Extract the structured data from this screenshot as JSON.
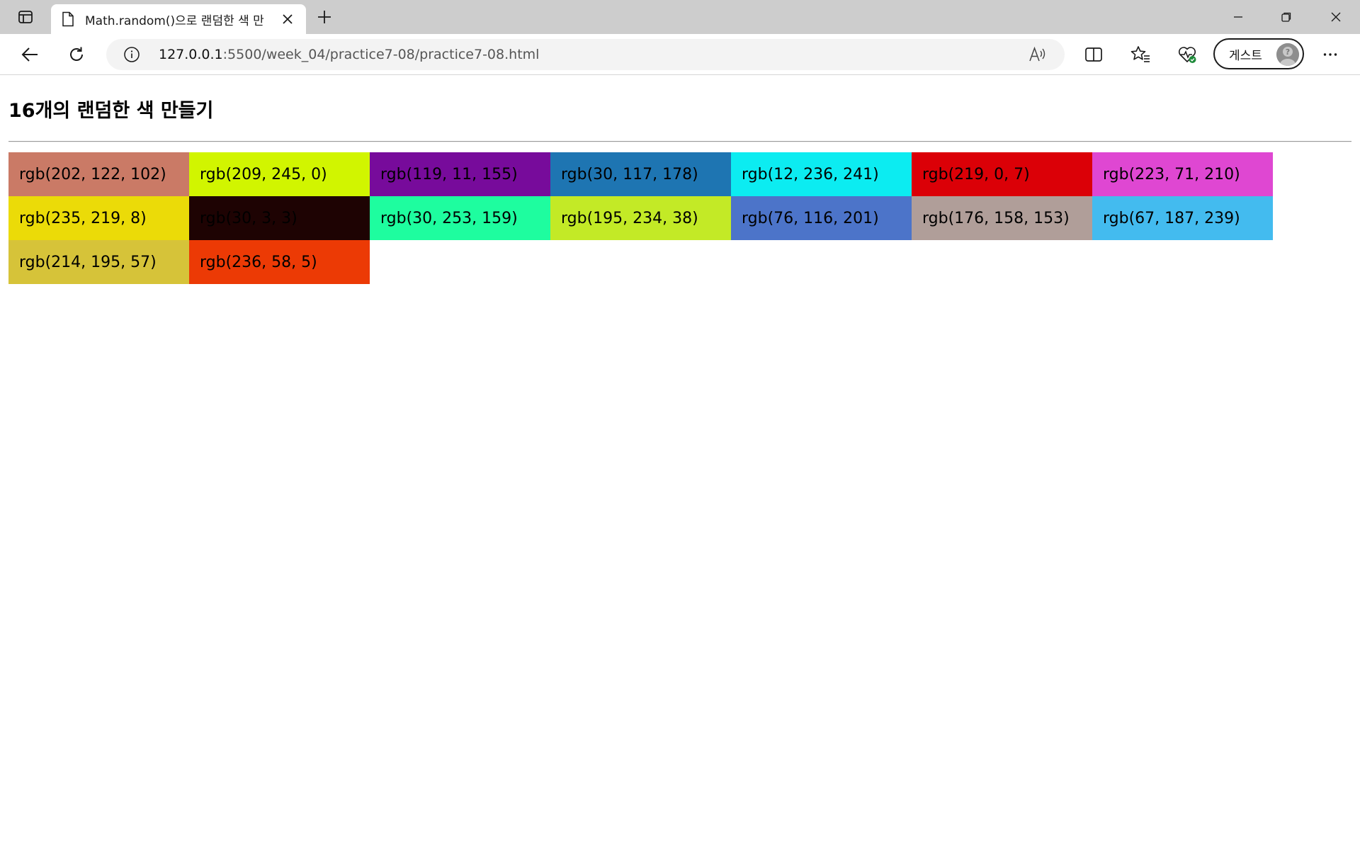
{
  "browser": {
    "tab_title": "Math.random()으로 랜덤한 색 만",
    "url_host": "127.0.0.1",
    "url_path": ":5500/week_04/practice7-08/practice7-08.html",
    "profile_label": "게스트",
    "icons": [
      "tab-actions-icon",
      "document-icon",
      "close-icon",
      "plus-icon",
      "minimize-icon",
      "restore-icon",
      "window-close-icon",
      "back-arrow-icon",
      "refresh-icon",
      "info-icon",
      "read-aloud-icon",
      "split-screen-icon",
      "favorites-icon",
      "browser-essentials-icon",
      "avatar-icon",
      "more-icon"
    ]
  },
  "page": {
    "title": "16개의 랜덤한 색 만들기",
    "swatches": [
      {
        "label": "rgb(202, 122, 102)",
        "color": "#ca7a66"
      },
      {
        "label": "rgb(209, 245, 0)",
        "color": "#d1f500"
      },
      {
        "label": "rgb(119, 11, 155)",
        "color": "#770b9b"
      },
      {
        "label": "rgb(30, 117, 178)",
        "color": "#1e75b2"
      },
      {
        "label": "rgb(12, 236, 241)",
        "color": "#0cecf1"
      },
      {
        "label": "rgb(219, 0, 7)",
        "color": "#db0007"
      },
      {
        "label": "rgb(223, 71, 210)",
        "color": "#df47d2"
      },
      {
        "label": "rgb(235, 219, 8)",
        "color": "#ebdb08"
      },
      {
        "label": "rgb(30, 3, 3)",
        "color": "#1e0303"
      },
      {
        "label": "rgb(30, 253, 159)",
        "color": "#1efd9f"
      },
      {
        "label": "rgb(195, 234, 38)",
        "color": "#c3ea26"
      },
      {
        "label": "rgb(76, 116, 201)",
        "color": "#4c74c9"
      },
      {
        "label": "rgb(176, 158, 153)",
        "color": "#b09e99"
      },
      {
        "label": "rgb(67, 187, 239)",
        "color": "#43bbef"
      },
      {
        "label": "rgb(214, 195, 57)",
        "color": "#d6c339"
      },
      {
        "label": "rgb(236, 58, 5)",
        "color": "#ec3a05"
      }
    ]
  }
}
